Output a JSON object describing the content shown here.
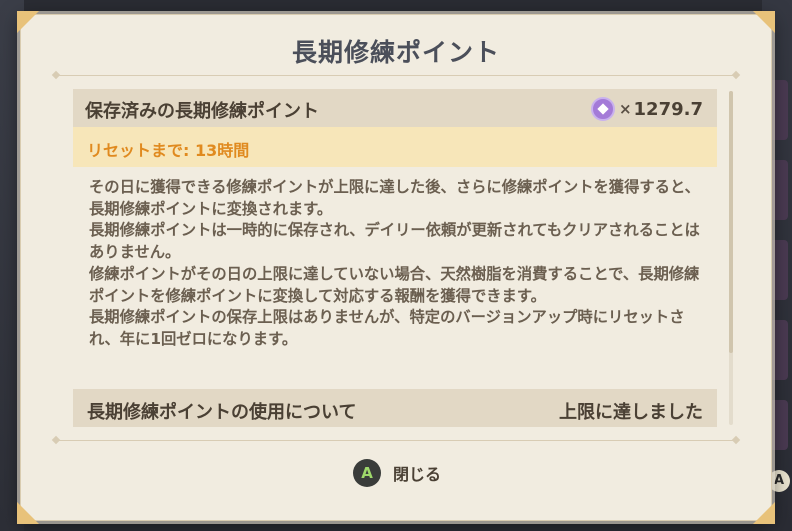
{
  "dialog": {
    "title": "長期修練ポイント",
    "stored": {
      "label": "保存済みの長期修練ポイント",
      "icon": "purple-star-icon",
      "multiplier": "×",
      "amount": "1279.7"
    },
    "reset": {
      "label": "リセットまで: 13時間"
    },
    "description": [
      "その日に獲得できる修練ポイントが上限に達した後、さらに修練ポイントを獲得すると、長期修練ポイントに変換されます。",
      "長期修練ポイントは一時的に保存され、デイリー依頼が更新されてもクリアされることはありません。",
      "修練ポイントがその日の上限に達していない場合、天然樹脂を消費することで、長期修練ポイントを修練ポイントに変換して対応する報酬を獲得できます。",
      "長期修練ポイントの保存上限はありませんが、特定のバージョンアップ時にリセットされ、年に1回ゼロになります。"
    ],
    "usage": {
      "label": "長期修練ポイントの使用について",
      "status": "上限に達しました"
    },
    "close": {
      "button_glyph": "A",
      "label": "閉じる"
    }
  },
  "background": {
    "right_chip": "A"
  },
  "colors": {
    "panel_bg": "#f1ece0",
    "row_bg": "#e2d8c5",
    "reset_bg": "#f7e6b9",
    "reset_text": "#e08a1f",
    "title_text": "#4b4f5a",
    "body_text": "#6b5f50",
    "accent_purple": "#a47bd8"
  }
}
